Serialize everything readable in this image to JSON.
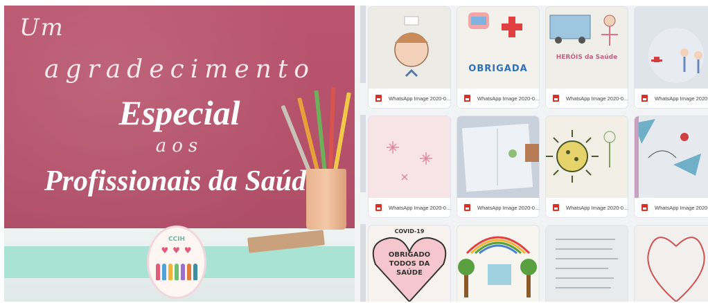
{
  "banner": {
    "line1": "Um",
    "line2": "agradecimento",
    "line3": "Especial",
    "line4": "aos",
    "line5": "Profissionais da Saúde",
    "logo_text": "CCIH"
  },
  "colors": {
    "wall": "#b3506a",
    "desk": "#eef3f2",
    "stripe": "#9fe0cf",
    "file_icon": "#d93025",
    "grid_bg": "#f1f3f4"
  },
  "gallery": {
    "files": [
      {
        "name": "WhatsApp Image 2020-0...",
        "icon": "image-file-icon",
        "drawing": "nurse-portrait"
      },
      {
        "name": "WhatsApp Image 2020-0...",
        "icon": "image-file-icon",
        "drawing": "obrigada-card"
      },
      {
        "name": "WhatsApp Image 2020-0...",
        "icon": "image-file-icon",
        "drawing": "heroes-ambulance"
      },
      {
        "name": "WhatsApp Image 2020-0...",
        "icon": "image-file-icon",
        "drawing": "health-workers"
      },
      {
        "name": "WhatsApp Image 2020-0...",
        "icon": "image-file-icon",
        "drawing": "flowers-pink"
      },
      {
        "name": "WhatsApp Image 2020-0...",
        "icon": "image-file-icon",
        "drawing": "notebook-drawing"
      },
      {
        "name": "WhatsApp Image 2020-0...",
        "icon": "image-file-icon",
        "drawing": "virus-drawing"
      },
      {
        "name": "WhatsApp Image 2020-0...",
        "icon": "image-file-icon",
        "drawing": "colorful-scene"
      },
      {
        "name": "",
        "icon": "",
        "drawing": "obrigado-heart"
      },
      {
        "name": "",
        "icon": "",
        "drawing": "rainbow-trees"
      },
      {
        "name": "",
        "icon": "",
        "drawing": "handwritten-letter"
      },
      {
        "name": "",
        "icon": "",
        "drawing": "heart-sketch"
      }
    ],
    "drawing_text": {
      "card": "OBRIGADA",
      "heroes": "HERÓIS da Saúde",
      "heart_top": "COVID-19",
      "heart": "OBRIGADO TODOS DA SAÚDE"
    }
  }
}
